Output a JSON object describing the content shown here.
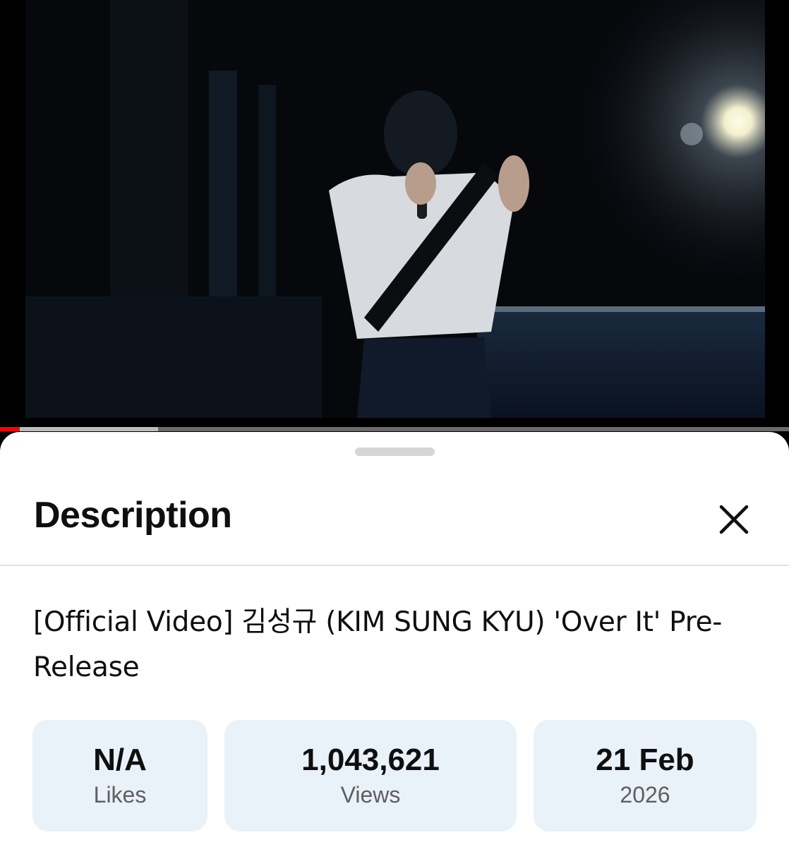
{
  "player": {
    "progress_played": 0.025,
    "progress_buffered": 0.2
  },
  "sheet": {
    "title": "Description",
    "close_icon": "close-icon"
  },
  "video": {
    "title": "[Official Video] 김성규 (KIM SUNG KYU) 'Over It' Pre-Release"
  },
  "stats": {
    "likes": {
      "value": "N/A",
      "label": "Likes"
    },
    "views": {
      "value": "1,043,621",
      "label": "Views"
    },
    "date": {
      "value": "21 Feb",
      "label": "2026"
    }
  },
  "colors": {
    "progress_played": "#ff0000",
    "stat_background": "#e9f1f9"
  }
}
